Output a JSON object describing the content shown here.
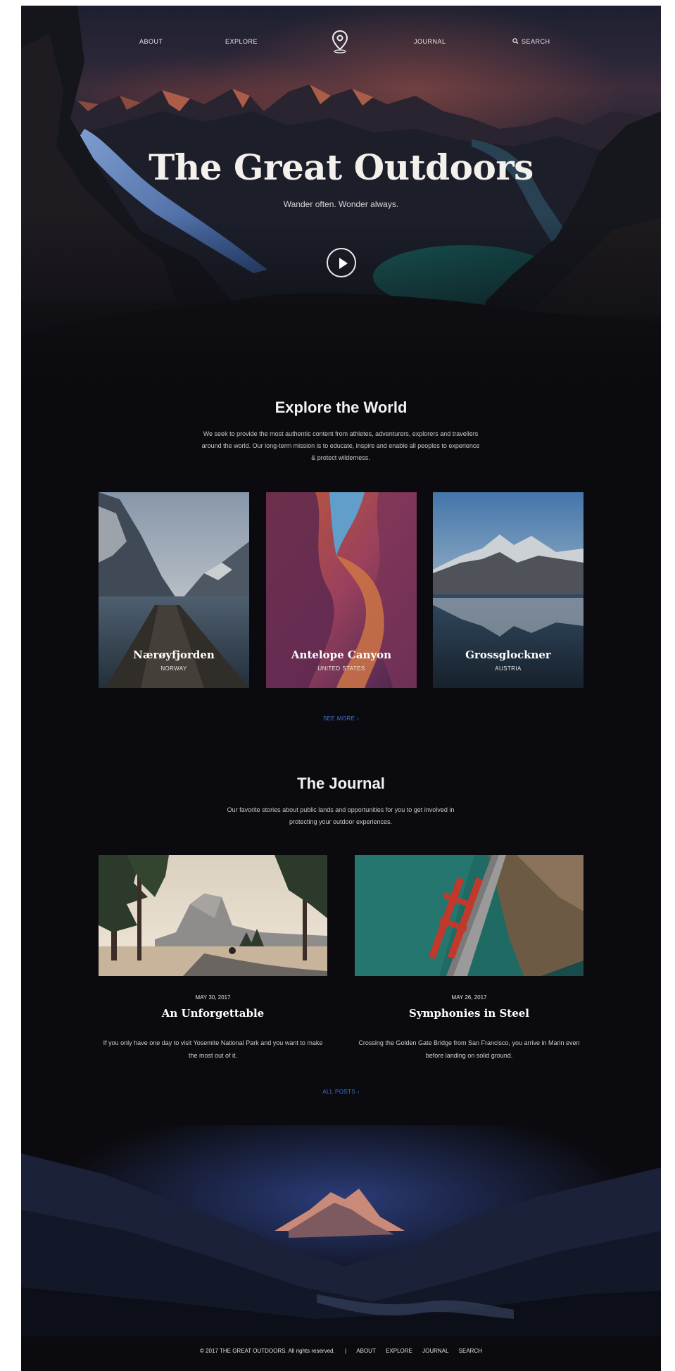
{
  "nav": {
    "about": "ABOUT",
    "explore": "EXPLORE",
    "journal": "JOURNAL",
    "search": "SEARCH"
  },
  "hero": {
    "title": "The Great Outdoors",
    "subtitle": "Wander often. Wonder always."
  },
  "explore": {
    "title": "Explore the World",
    "text": "We seek to provide the most authentic content from athletes, adventurers, explorers and travellers around the world. Our long-term mission is to educate, inspire and enable all peoples to experience & protect wilderness.",
    "places": [
      {
        "name": "Nærøyfjorden",
        "country": "NORWAY"
      },
      {
        "name": "Antelope Canyon",
        "country": "UNITED STATES"
      },
      {
        "name": "Grossglockner",
        "country": "AUSTRIA"
      }
    ],
    "see_more": "SEE MORE ›"
  },
  "journal": {
    "title": "The Journal",
    "text": "Our favorite stories about public lands and opportunities for you to get involved in protecting your outdoor experiences.",
    "posts": [
      {
        "date": "MAY 30, 2017",
        "title": "An Unforgettable",
        "excerpt": "If you only have one day to visit Yosemite National Park and you want to make the most out of it."
      },
      {
        "date": "MAY 26, 2017",
        "title": "Symphonies in Steel",
        "excerpt": "Crossing the Golden Gate Bridge from San Francisco, you arrive in Marin even before landing on solid ground."
      }
    ],
    "all_posts": "ALL POSTS ›"
  },
  "footer": {
    "copyright": "© 2017 THE GREAT OUTDOORS. All rights reserved.",
    "separator": "|",
    "links": [
      "ABOUT",
      "EXPLORE",
      "JOURNAL",
      "SEARCH"
    ]
  },
  "icons": {
    "logo": "map-pin-icon",
    "search": "search-icon",
    "play": "play-icon"
  },
  "colors": {
    "background": "#0b0b0f",
    "link_accent": "#3f74d8"
  }
}
